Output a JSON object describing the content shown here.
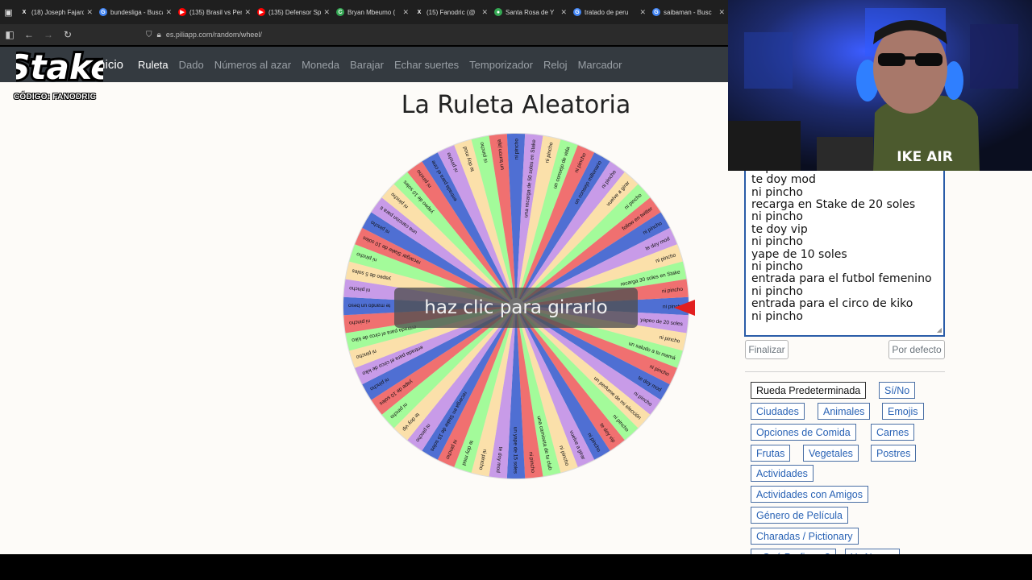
{
  "browser": {
    "tabs": [
      {
        "label": "(18) Joseph Fajardo",
        "icon": "x-logo-icon",
        "color": "#000000"
      },
      {
        "label": "bundesliga - Buscar",
        "icon": "google-icon",
        "color": "#4285f4"
      },
      {
        "label": "(135) Brasil vs Perú",
        "icon": "youtube-icon",
        "color": "#ff0000"
      },
      {
        "label": "(135) Defensor Sp",
        "icon": "youtube-icon",
        "color": "#ff0000"
      },
      {
        "label": "Bryan Mbeumo (",
        "icon": "chrome-icon",
        "color": "#34a853"
      },
      {
        "label": "(15) Fanodric (@",
        "icon": "x-logo-icon",
        "color": "#000000"
      },
      {
        "label": "Santa Rosa de Y",
        "icon": "maps-pin-icon",
        "color": "#34a853"
      },
      {
        "label": "tratado de peru",
        "icon": "google-icon",
        "color": "#4285f4"
      },
      {
        "label": "saibaman - Busc",
        "icon": "google-icon",
        "color": "#4285f4"
      }
    ],
    "url": "es.piliapp.com/random/wheel/"
  },
  "nav": {
    "home": "Inicio",
    "links": [
      "Ruleta",
      "Dado",
      "Números al azar",
      "Moneda",
      "Barajar",
      "Echar suertes",
      "Temporizador",
      "Reloj",
      "Marcador"
    ],
    "active": "Ruleta"
  },
  "overlay": {
    "logo_text": "Stake",
    "code": "CÓDIGO: FANODRIC"
  },
  "page": {
    "title": "La Ruleta Aleatoria",
    "spin_label": "haz clic para girarlo"
  },
  "wheel": {
    "colors": [
      "#4f6fd3",
      "#c89be8",
      "#fbe0aa",
      "#a3fb9a",
      "#f07070"
    ],
    "labels": [
      "ni pincho",
      "yapeo de 20 soles",
      "ni pincho",
      "un saludo a tu mamá",
      "ni pincho",
      "te doy mod",
      "ni pincho",
      "un perfume de mi elección",
      "ni pincho",
      "te doy vip",
      "ni pincho",
      "vuelve a girar",
      "ni pincho",
      "una camiseta de tu club",
      "ni pincho",
      "un yape de 15 soles",
      "te doy mod",
      "ni pincho",
      "te doy mod",
      "ni pincho",
      "recarga en Stake de 15 soles",
      "ni pincho",
      "te doy vip",
      "ni pincho",
      "yape de 10 soles",
      "ni pincho",
      "entrada para el circo de kiko",
      "ni pincho",
      "entrada para el circo de kiko",
      "ni pincho",
      "te mando un beso",
      "ni pincho",
      "yapeo de 5 soles",
      "ni pincho",
      "recargar Stake de 10 soles",
      "ni pincho",
      "una cancion para ti",
      "ni pincho",
      "yapeo de 10 soles",
      "ni pincho",
      "entrada para el cine",
      "ni pincho",
      "te doy mod",
      "ni pincho",
      "un turron jaja",
      "ni pincho",
      "una recarga de 50 soles en Stake",
      "ni pincho",
      "un consejo de vida",
      "ni pincho",
      "un consejo millonario",
      "ni pincho",
      "vuelve a girar",
      "ni pincho",
      "follow en twitter",
      "ni pincho",
      "te doy mod",
      "ni pincho",
      "recarga 30 soles en Stake",
      "ni pincho"
    ]
  },
  "options": {
    "lines": [
      "ni pincho",
      "te doy mod",
      "ni pincho",
      "recarga en Stake de 20 soles",
      "ni pincho",
      "te doy vip",
      "ni pincho",
      "yape de 10 soles",
      "ni pincho",
      "entrada para el futbol femenino",
      "ni pincho",
      "entrada para el circo de kiko",
      "ni pincho"
    ],
    "finalize_label": "Finalizar",
    "default_label": "Por defecto"
  },
  "presets": {
    "items": [
      "Rueda Predeterminada",
      "Sí/No",
      "Ciudades",
      "Animales",
      "Emojis",
      "Opciones de Comida",
      "Carnes",
      "Frutas",
      "Vegetales",
      "Postres",
      "Actividades",
      "Actividades con Amigos",
      "Género de Película",
      "Charadas / Pictionary",
      "¿Qué Prefieres?",
      "Yo Nunca"
    ]
  },
  "webcam": {
    "shirt_text": "IKE AIR"
  }
}
